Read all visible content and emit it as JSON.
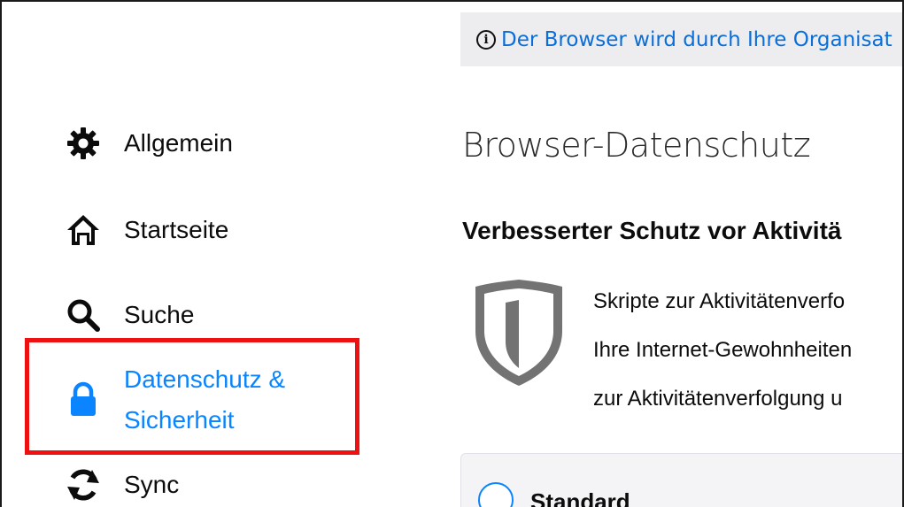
{
  "notice": {
    "icon": "info-circle-icon",
    "text": "Der Browser wird durch Ihre Organisat"
  },
  "sidebar": {
    "items": [
      {
        "label": "Allgemein",
        "icon": "gear-icon",
        "selected": false
      },
      {
        "label": "Startseite",
        "icon": "home-icon",
        "selected": false
      },
      {
        "label": "Suche",
        "icon": "search-icon",
        "selected": false
      },
      {
        "label_line1": "Datenschutz &",
        "label_line2": "Sicherheit",
        "icon": "lock-icon",
        "selected": true
      },
      {
        "label": "Sync",
        "icon": "sync-icon",
        "selected": false
      }
    ]
  },
  "main": {
    "title": "Browser-Datenschutz",
    "section_title": "Verbesserter Schutz vor Aktivitä",
    "description_lines": [
      "Skripte zur Aktivitätenverfo",
      "Ihre Internet-Gewohnheiten",
      "zur Aktivitätenverfolgung u"
    ],
    "option": {
      "label": "Standard",
      "selected": false
    }
  },
  "colors": {
    "accent": "#0a84ff",
    "link": "#0a6ed8",
    "highlight": "#ee1111",
    "notice_bg": "#ededf0"
  }
}
